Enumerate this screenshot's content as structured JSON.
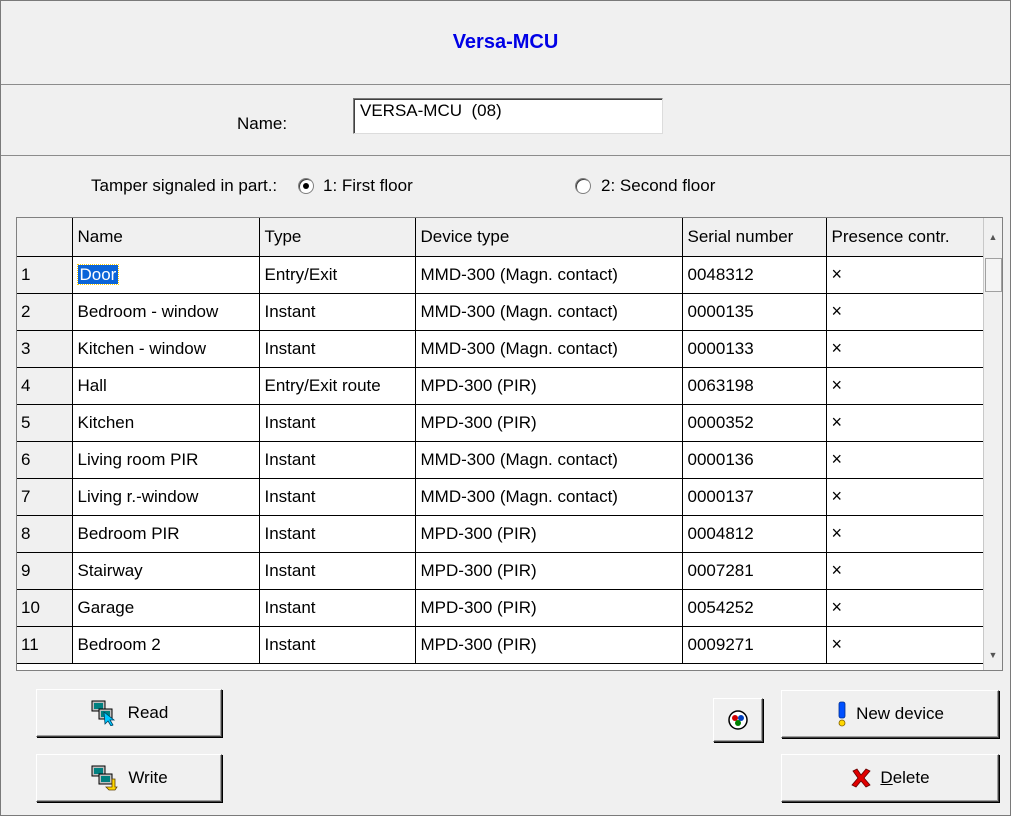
{
  "window": {
    "title": "Versa-MCU"
  },
  "name_field": {
    "label": "Name:",
    "value": "VERSA-MCU  (08)"
  },
  "tamper": {
    "label": "Tamper signaled in part.:",
    "options": [
      {
        "label": "1: First floor",
        "selected": true
      },
      {
        "label": "2: Second floor",
        "selected": false
      }
    ]
  },
  "grid": {
    "columns": [
      "",
      "Name",
      "Type",
      "Device type",
      "Serial number",
      "Presence contr."
    ],
    "rows": [
      {
        "num": "1",
        "name": "Door",
        "type": "Entry/Exit",
        "device": "MMD-300 (Magn. contact)",
        "serial": "0048312",
        "presence": "×"
      },
      {
        "num": "2",
        "name": "Bedroom - window",
        "type": "Instant",
        "device": "MMD-300 (Magn. contact)",
        "serial": "0000135",
        "presence": "×"
      },
      {
        "num": "3",
        "name": "Kitchen - window",
        "type": "Instant",
        "device": "MMD-300 (Magn. contact)",
        "serial": "0000133",
        "presence": "×"
      },
      {
        "num": "4",
        "name": "Hall",
        "type": "Entry/Exit route",
        "device": "MPD-300 (PIR)",
        "serial": "0063198",
        "presence": "×"
      },
      {
        "num": "5",
        "name": "Kitchen",
        "type": "Instant",
        "device": "MPD-300 (PIR)",
        "serial": "0000352",
        "presence": "×"
      },
      {
        "num": "6",
        "name": "Living room PIR",
        "type": "Instant",
        "device": "MMD-300 (Magn. contact)",
        "serial": "0000136",
        "presence": "×"
      },
      {
        "num": "7",
        "name": "Living r.-window",
        "type": "Instant",
        "device": "MMD-300 (Magn. contact)",
        "serial": "0000137",
        "presence": "×"
      },
      {
        "num": "8",
        "name": "Bedroom PIR",
        "type": "Instant",
        "device": "MPD-300 (PIR)",
        "serial": "0004812",
        "presence": "×"
      },
      {
        "num": "9",
        "name": "Stairway",
        "type": "Instant",
        "device": "MPD-300 (PIR)",
        "serial": "0007281",
        "presence": "×"
      },
      {
        "num": "10",
        "name": "Garage",
        "type": "Instant",
        "device": "MPD-300 (PIR)",
        "serial": "0054252",
        "presence": "×"
      },
      {
        "num": "11",
        "name": "Bedroom 2",
        "type": "Instant",
        "device": "MPD-300 (PIR)",
        "serial": "0009271",
        "presence": "×"
      }
    ]
  },
  "buttons": {
    "read": "Read",
    "write": "Write",
    "new_device": "New device",
    "delete_prefix": "D",
    "delete_rest": "elete"
  },
  "icons": {
    "read": "read-from-device-icon",
    "write": "write-to-device-icon",
    "test": "test-signal-icon",
    "new_device": "exclamation-icon",
    "delete": "red-x-icon"
  },
  "colors": {
    "title": "#0000e6",
    "selection": "#0a64d8"
  }
}
